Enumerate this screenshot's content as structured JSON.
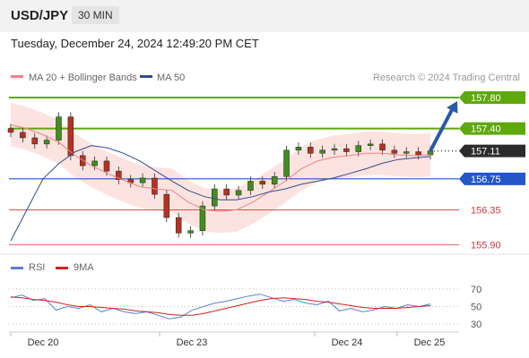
{
  "header": {
    "symbol": "USD/JPY",
    "timeframe": "30 MIN"
  },
  "timestamp": "Tuesday, December 24, 2024 12:49:20 PM CET",
  "colors": {
    "resistance": "#5fa80a",
    "pivot": "#2456c8",
    "support": "#d03a3a",
    "bb_fill": "#fde3e0",
    "ma20": "#f08080",
    "ma50": "#2c4f8f",
    "candle_up": "#3f8f1f",
    "candle_down": "#b83020",
    "rsi": "#5b7fd6",
    "rsi_ma": "#d42020"
  },
  "legend": {
    "ma20": "MA 20 + Bollinger Bands",
    "ma50": "MA 50"
  },
  "credit": "Research © 2024 Trading Central",
  "osc_legend": {
    "rsi": "RSI",
    "ma": "9MA"
  },
  "chart_data": [
    {
      "type": "candlestick",
      "ylim": [
        155.8,
        157.95
      ],
      "x_ticks": [
        "Dec 20",
        "Dec 23",
        "Dec 24",
        "Dec 25"
      ],
      "levels": [
        {
          "value": 157.8,
          "label": "157.80",
          "kind": "resistance"
        },
        {
          "value": 157.4,
          "label": "157.40",
          "kind": "resistance"
        },
        {
          "value": 157.11,
          "label": "157.11",
          "kind": "last"
        },
        {
          "value": 156.75,
          "label": "156.75",
          "kind": "pivot"
        },
        {
          "value": 156.35,
          "label": "156.35",
          "kind": "support"
        },
        {
          "value": 155.9,
          "label": "155.90",
          "kind": "support"
        }
      ],
      "series": [
        {
          "name": "MA 20",
          "values": [
            157.45,
            157.4,
            157.32,
            157.22,
            157.05,
            156.92,
            156.82,
            156.73,
            156.65,
            156.62,
            156.6,
            156.45,
            156.35,
            156.33,
            156.35,
            156.45,
            156.58,
            156.72,
            156.88,
            156.98,
            157.03,
            157.05,
            157.08,
            157.08,
            157.06,
            157.05,
            157.06
          ]
        },
        {
          "name": "MA 50",
          "values": [
            155.95,
            156.35,
            156.75,
            156.95,
            157.1,
            157.18,
            157.15,
            157.08,
            156.98,
            156.85,
            156.72,
            156.6,
            156.52,
            156.48,
            156.48,
            156.52,
            156.58,
            156.62,
            156.68,
            156.72,
            156.76,
            156.82,
            156.88,
            156.95,
            157.0,
            157.02,
            157.04
          ]
        },
        {
          "name": "Close",
          "values": [
            157.35,
            157.28,
            157.2,
            157.25,
            157.55,
            157.05,
            156.92,
            156.98,
            156.85,
            156.74,
            156.7,
            156.76,
            156.55,
            156.25,
            156.05,
            156.08,
            156.4,
            156.62,
            156.54,
            156.6,
            156.72,
            156.68,
            156.78,
            157.12,
            157.16,
            157.08,
            157.12,
            157.14,
            157.1,
            157.18,
            157.2,
            157.12,
            157.08,
            157.1,
            157.06,
            157.11
          ]
        }
      ]
    },
    {
      "type": "line",
      "ylim": [
        20,
        80
      ],
      "y_ticks": [
        70,
        50,
        30
      ],
      "series": [
        {
          "name": "RSI",
          "values": [
            60,
            63,
            57,
            59,
            46,
            50,
            48,
            52,
            44,
            48,
            44,
            42,
            44,
            40,
            36,
            38,
            46,
            50,
            54,
            56,
            59,
            62,
            64,
            60,
            56,
            58,
            54,
            52,
            56,
            45,
            48,
            44,
            46,
            50,
            48,
            52,
            50,
            53
          ]
        },
        {
          "name": "9MA",
          "values": [
            61,
            60,
            58,
            57,
            55,
            52,
            50,
            50,
            49,
            48,
            47,
            45,
            44,
            43,
            41,
            40,
            40,
            42,
            45,
            48,
            51,
            54,
            57,
            59,
            60,
            59,
            58,
            56,
            55,
            53,
            51,
            49,
            48,
            48,
            48,
            49,
            50,
            51
          ]
        }
      ]
    }
  ]
}
